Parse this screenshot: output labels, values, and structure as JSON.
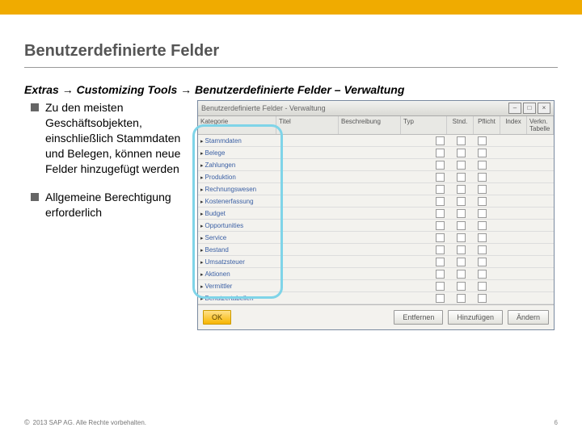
{
  "slide": {
    "title": "Benutzerdefinierte Felder",
    "breadcrumb": "Extras → Customizing Tools → Benutzerdefinierte Felder – Verwaltung",
    "bullets": [
      "Zu den meisten Geschäftsobjekten, einschließlich Stammdaten und Belegen, können neue Felder hinzugefügt werden",
      "Allgemeine Berechtigung erforderlich"
    ]
  },
  "window": {
    "title": "Benutzerdefinierte Felder - Verwaltung",
    "headers": {
      "category": "Kategorie",
      "title": "Titel",
      "description": "Beschreibung",
      "type": "Typ",
      "active": "Stnd.",
      "mandatory": "Pflicht",
      "index": "Index",
      "linked_table": "Verkn. Tabelle"
    },
    "categories": [
      "Stammdaten",
      "Belege",
      "Zahlungen",
      "Produktion",
      "Rechnungswesen",
      "Kostenerfassung",
      "Budget",
      "Opportunities",
      "Service",
      "Bestand",
      "Umsatzsteuer",
      "Aktionen",
      "Vermittler",
      "Benutzertabellen"
    ],
    "buttons": {
      "ok": "OK",
      "remove": "Entfernen",
      "add": "Hinzufügen",
      "update": "Ändern"
    }
  },
  "footer": {
    "copyright": "2013 SAP AG. Alle Rechte vorbehalten.",
    "page": "6"
  }
}
